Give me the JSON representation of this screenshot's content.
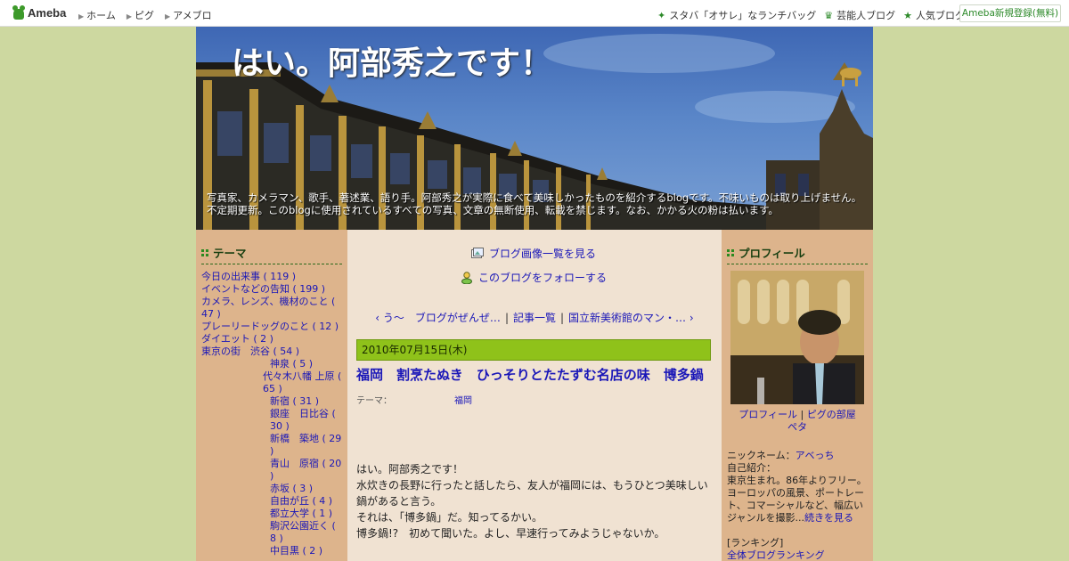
{
  "topbar": {
    "logo": "Ameba",
    "nav": [
      "ホーム",
      "ピグ",
      "アメブロ"
    ],
    "right": [
      {
        "label": "スタバ「オサレ」なランチバッグ",
        "icon": "sparkle-icon"
      },
      {
        "label": "芸能人ブログ",
        "icon": "crown-icon"
      },
      {
        "label": "人気ブログ",
        "icon": "star-icon"
      }
    ],
    "register": "Ameba新規登録(無料)"
  },
  "header": {
    "title": "はい。阿部秀之です！",
    "description": "写真家、カメラマン、歌手、著述業、語り手。阿部秀之が実際に食べて美味しかったものを紹介するblogです。不味いものは取り上げません。不定期更新。このblogに使用されているすべての写真、文章の無断使用、転載を禁じます。なお、かかる火の粉は払います。"
  },
  "left": {
    "heading": "テーマ",
    "themes": [
      "今日の出来事 ( 119 )",
      "イベントなどの告知 ( 199 )",
      "カメラ、レンズ、機材のこと ( 47 )",
      "プレーリードッグのこと ( 12 )",
      "ダイエット ( 2 )",
      "東京の街　渋谷 ( 54 )",
      "神泉 ( 5 )",
      "代々木八幡 上原 ( 65 )",
      "新宿 ( 31 )",
      "銀座　日比谷 ( 30 )",
      "新橋　築地 ( 29 )",
      "青山　原宿 ( 20 )",
      "赤坂 ( 3 )",
      "自由が丘 ( 4 )",
      "都立大学 ( 1 )",
      "駒沢公園近く ( 8 )",
      "中目黒 ( 2 )"
    ]
  },
  "center": {
    "image_list_link": "ブログ画像一覧を見る",
    "follow_link": "このブログをフォローする",
    "prev_link": "う～　ブログがぜんぜ…",
    "article_list": "記事一覧",
    "next_link": "国立新美術館のマン・…",
    "date": "2010年07月15日(木)",
    "entry_title": "福岡　割烹たぬき　ひっそりとたたずむ名店の味　博多鍋",
    "theme_label": "テーマ：",
    "theme_value": "福岡",
    "body": [
      "はい。阿部秀之です！",
      "水炊きの長野に行ったと話したら、友人が福岡には、もうひとつ美味しい鍋があると言う。",
      "それは、「博多鍋」だ。知ってるかい。",
      "博多鍋!?　初めて聞いた。よし、早速行ってみようじゃないか。"
    ]
  },
  "right": {
    "heading": "プロフィール",
    "profile_link": "プロフィール",
    "pig_link": "ピグの部屋",
    "peta_link": "ペタ",
    "nickname_label": "ニックネーム：",
    "nickname": "アベっち",
    "intro_label": "自己紹介：",
    "intro": "東京生まれ。86年よりフリー。ヨーロッパの風景、ポートレート、コマーシャルなど、幅広いジャンルを撮影...",
    "more": "続きを見る",
    "ranking_label": "[ランキング]",
    "ranking_link": "全体ブログランキング"
  }
}
